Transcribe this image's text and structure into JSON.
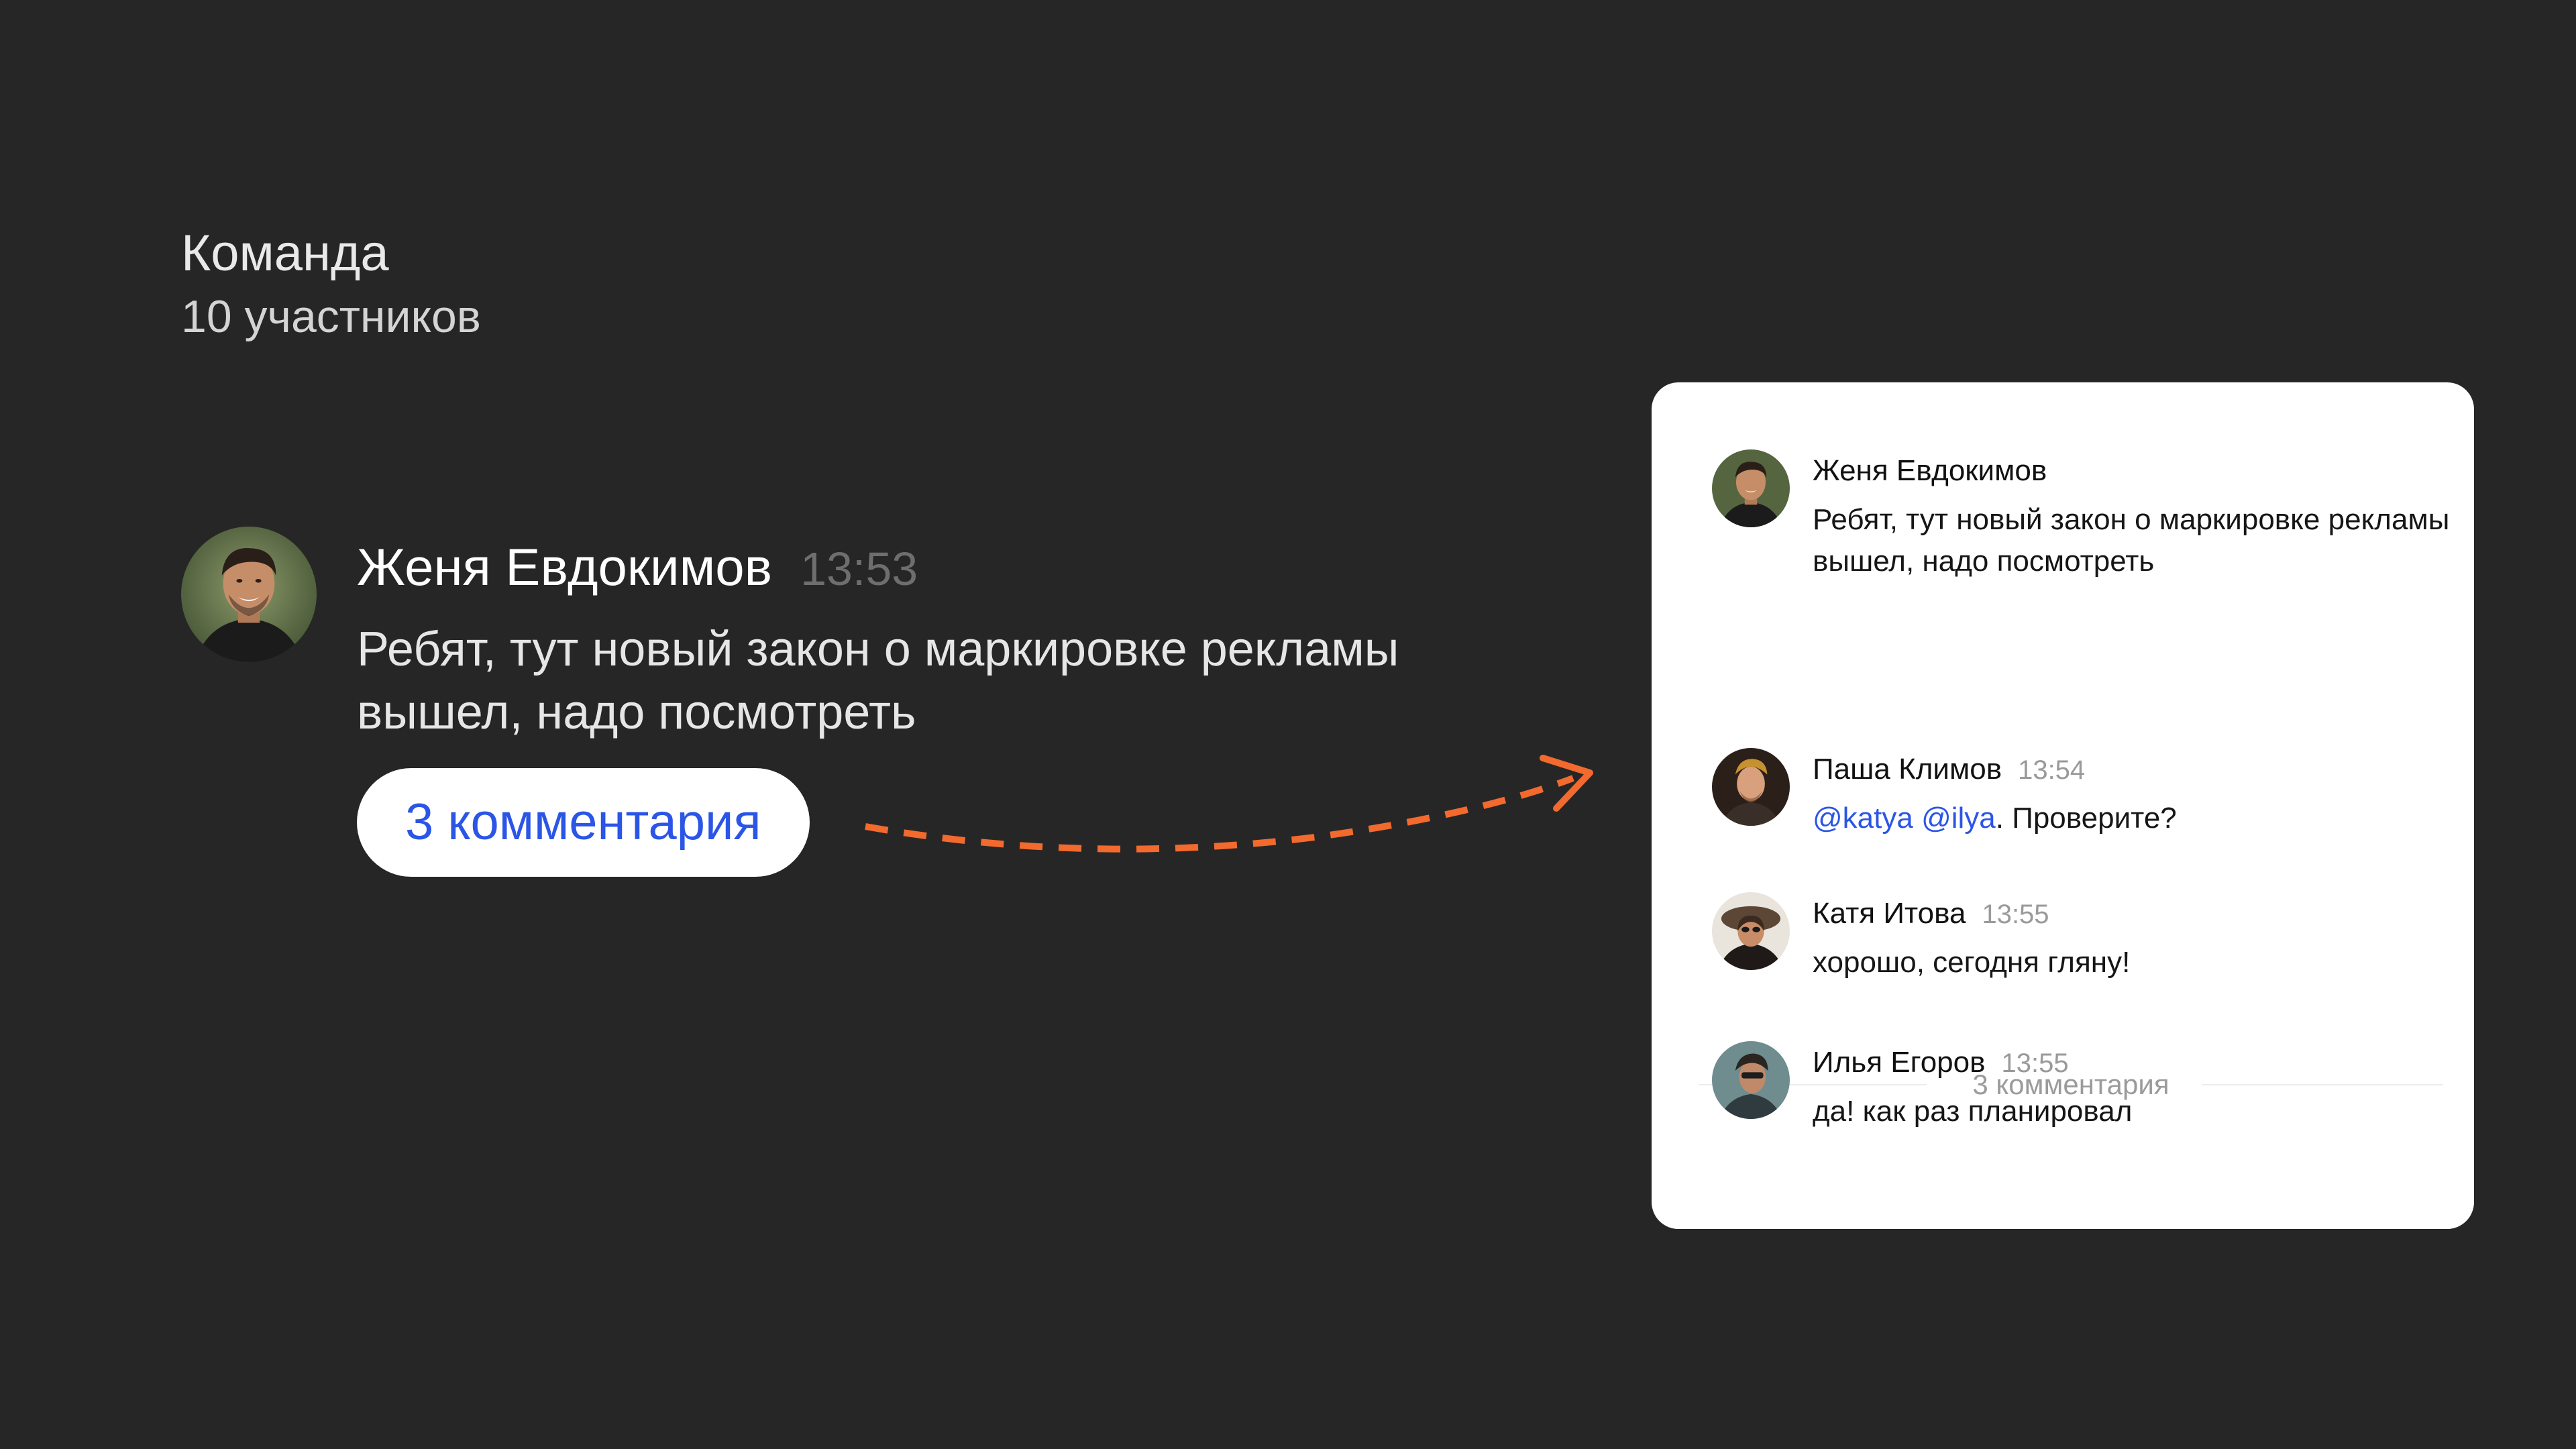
{
  "chat": {
    "title": "Команда",
    "members": "10 участников"
  },
  "main_message": {
    "author": "Женя Евдокимов",
    "time": "13:53",
    "text": "Ребят, тут новый закон о маркировке рекламы вышел, надо посмотреть",
    "comments_button": "3 комментария"
  },
  "thread": {
    "root": {
      "author": "Женя Евдокимов",
      "text": "Ребят, тут новый закон о маркировке рекламы вышел, надо посмотреть"
    },
    "divider_label": "3 комментария",
    "comments": [
      {
        "author": "Паша Климов",
        "time": "13:54",
        "mention1": "@katya",
        "mention2": "@ilya",
        "text_rest": ". Проверите?"
      },
      {
        "author": "Катя Итова",
        "time": "13:55",
        "text": "хорошо, сегодня гляну!"
      },
      {
        "author": "Илья Егоров",
        "time": "13:55",
        "text": "да! как раз планировал"
      }
    ]
  },
  "colors": {
    "background": "#262626",
    "accent_blue": "#2b55e6",
    "arrow_orange": "#f26a2e",
    "panel": "#ffffff"
  },
  "icons": {
    "arrow": "dashed-curved-arrow-icon"
  }
}
